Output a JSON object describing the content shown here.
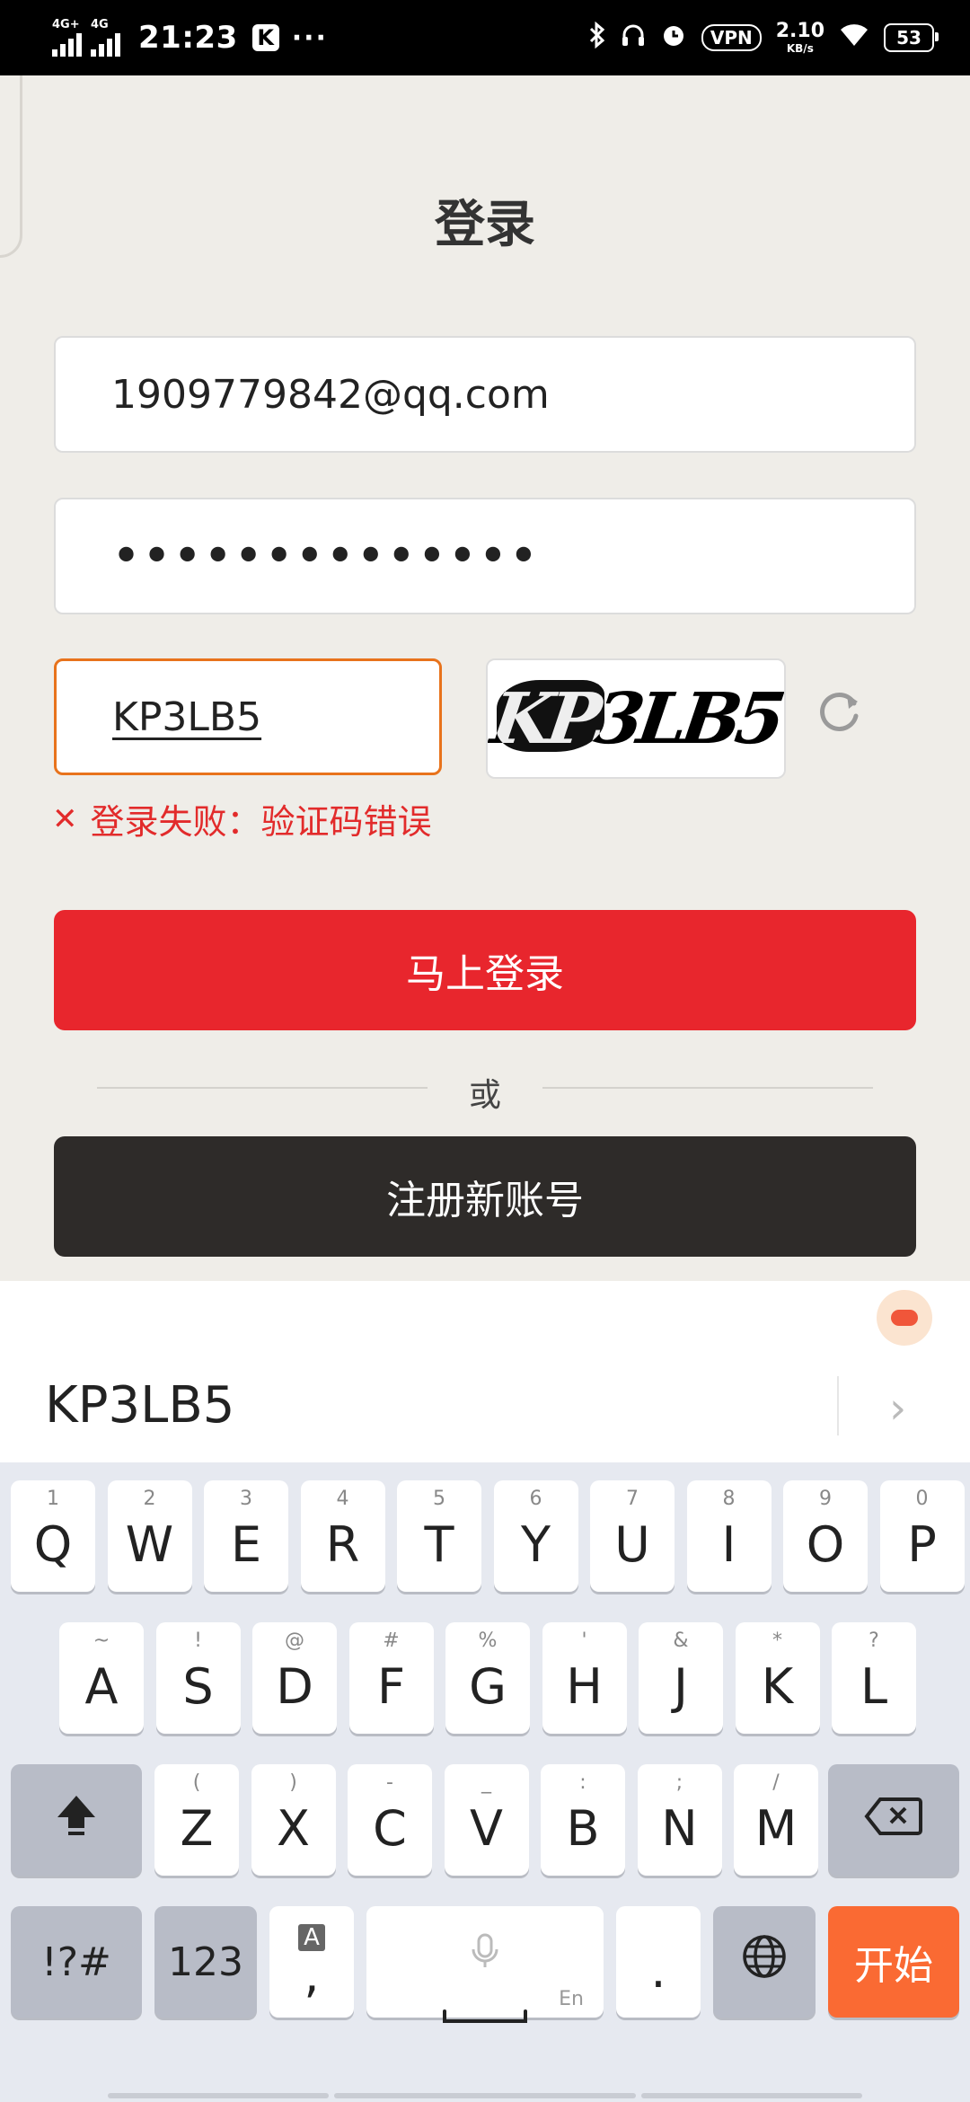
{
  "status_bar": {
    "sim1": "4G+",
    "sim2": "4G",
    "time": "21:23",
    "app_badge": "K",
    "more": "···",
    "vpn": "VPN",
    "speed_value": "2.10",
    "speed_unit": "KB/s",
    "battery": "53"
  },
  "login": {
    "title": "登录",
    "email_value": "1909779842@qq.com",
    "password_masked": "••••••••••••••",
    "captcha_value": "KP3LB5",
    "captcha_image_text": "KP3LB5",
    "error_message": "登录失败：验证码错误",
    "login_button": "马上登录",
    "divider_text": "或",
    "register_button": "注册新账号"
  },
  "keyboard": {
    "candidate": "KP3LB5",
    "row1": [
      {
        "key": "Q",
        "hint": "1"
      },
      {
        "key": "W",
        "hint": "2"
      },
      {
        "key": "E",
        "hint": "3"
      },
      {
        "key": "R",
        "hint": "4"
      },
      {
        "key": "T",
        "hint": "5"
      },
      {
        "key": "Y",
        "hint": "6"
      },
      {
        "key": "U",
        "hint": "7"
      },
      {
        "key": "I",
        "hint": "8"
      },
      {
        "key": "O",
        "hint": "9"
      },
      {
        "key": "P",
        "hint": "0"
      }
    ],
    "row2": [
      {
        "key": "A",
        "hint": "~"
      },
      {
        "key": "S",
        "hint": "!"
      },
      {
        "key": "D",
        "hint": "@"
      },
      {
        "key": "F",
        "hint": "#"
      },
      {
        "key": "G",
        "hint": "%"
      },
      {
        "key": "H",
        "hint": "'"
      },
      {
        "key": "J",
        "hint": "&"
      },
      {
        "key": "K",
        "hint": "*"
      },
      {
        "key": "L",
        "hint": "?"
      }
    ],
    "row3": [
      {
        "key": "Z",
        "hint": "("
      },
      {
        "key": "X",
        "hint": ")"
      },
      {
        "key": "C",
        "hint": "-"
      },
      {
        "key": "V",
        "hint": "_"
      },
      {
        "key": "B",
        "hint": ":"
      },
      {
        "key": "N",
        "hint": ";"
      },
      {
        "key": "M",
        "hint": "/"
      }
    ],
    "symbols_key": "!?#",
    "numbers_key": "123",
    "comma_key": ",",
    "comma_hint": "A",
    "space_sub": "En",
    "period_key": ".",
    "start_key": "开始"
  }
}
